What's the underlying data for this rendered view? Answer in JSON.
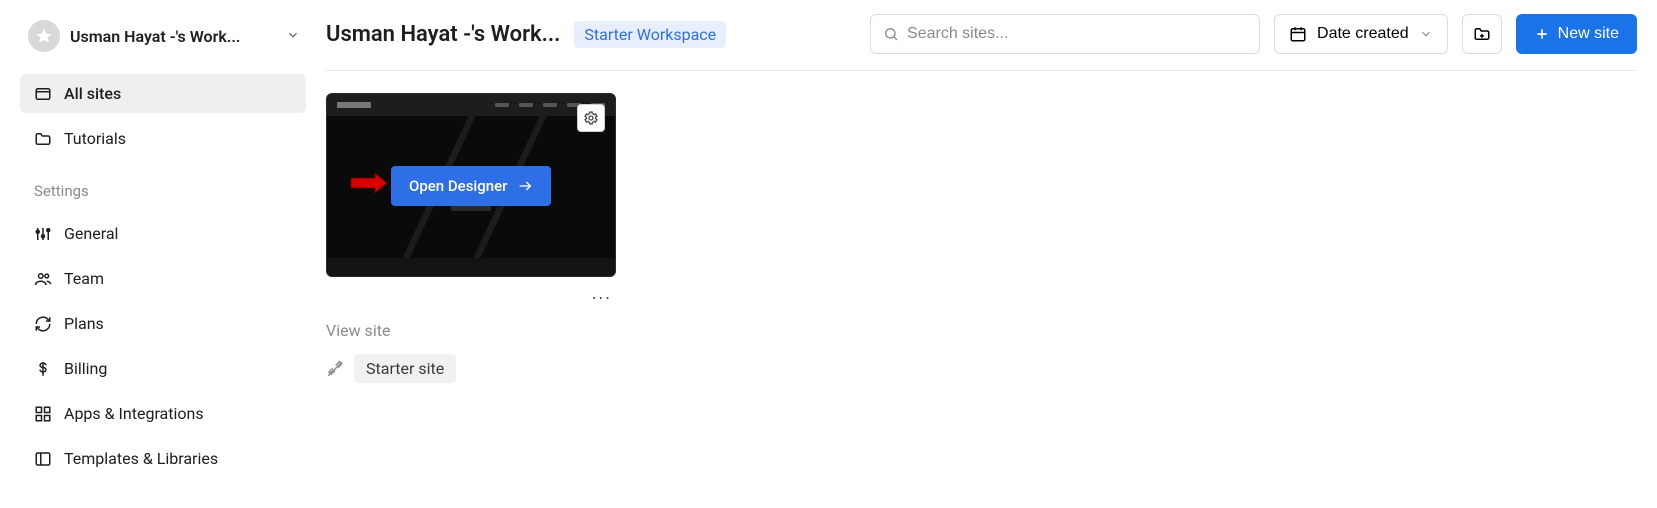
{
  "sidebar": {
    "workspace_name": "Usman Hayat -'s Work...",
    "items": [
      {
        "label": "All sites",
        "icon": "browser-icon"
      },
      {
        "label": "Tutorials",
        "icon": "folder-icon"
      }
    ],
    "settings_heading": "Settings",
    "settings_items": [
      {
        "label": "General",
        "icon": "sliders-icon"
      },
      {
        "label": "Team",
        "icon": "people-icon"
      },
      {
        "label": "Plans",
        "icon": "refresh-icon"
      },
      {
        "label": "Billing",
        "icon": "dollar-icon"
      },
      {
        "label": "Apps & Integrations",
        "icon": "grid-icon"
      },
      {
        "label": "Templates & Libraries",
        "icon": "panel-icon"
      }
    ]
  },
  "header": {
    "title": "Usman Hayat -'s Work...",
    "badge": "Starter Workspace",
    "search_placeholder": "Search sites...",
    "sort_label": "Date created",
    "new_site_label": "New site"
  },
  "card": {
    "open_designer_label": "Open Designer",
    "dots": "...",
    "view_site_label": "View site",
    "site_name": "Starter site"
  }
}
